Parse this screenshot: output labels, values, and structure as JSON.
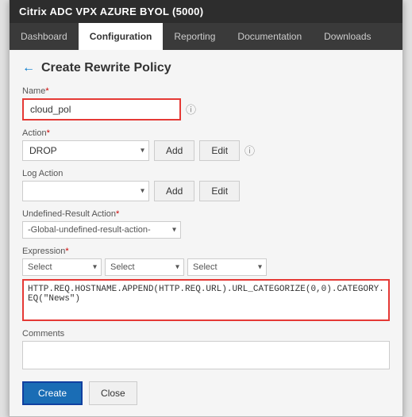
{
  "window": {
    "title": "Citrix ADC VPX AZURE BYOL (5000)"
  },
  "nav": {
    "items": [
      {
        "label": "Dashboard",
        "active": false
      },
      {
        "label": "Configuration",
        "active": true
      },
      {
        "label": "Reporting",
        "active": false
      },
      {
        "label": "Documentation",
        "active": false
      },
      {
        "label": "Downloads",
        "active": false
      }
    ]
  },
  "page": {
    "title": "Create Rewrite Policy"
  },
  "form": {
    "name_label": "Name",
    "name_value": "cloud_pol",
    "action_label": "Action",
    "action_value": "DROP",
    "action_add_label": "Add",
    "action_edit_label": "Edit",
    "log_action_label": "Log Action",
    "log_action_value": "",
    "log_add_label": "Add",
    "log_edit_label": "Edit",
    "undefined_label": "Undefined-Result Action",
    "undefined_value": "-Global-undefined-result-action-",
    "expression_label": "Expression",
    "select1": "Select",
    "select2": "Select",
    "select3": "Select",
    "expression_value": "HTTP.REQ.HOSTNAME.APPEND(HTTP.REQ.URL).URL_CATEGORIZE(0,0).CATEGORY.EQ(\"News\")",
    "comments_label": "Comments",
    "comments_value": "",
    "create_label": "Create",
    "close_label": "Close"
  }
}
